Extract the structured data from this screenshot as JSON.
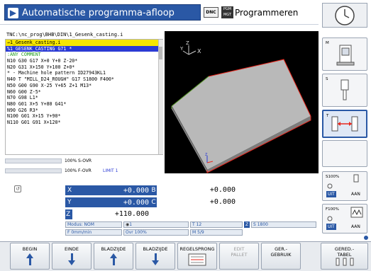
{
  "header": {
    "mode_title": "Automatische programma-afloop",
    "dnc_label": "DNC",
    "pgm_label": "PGM MGT",
    "programming_label": "Programmeren"
  },
  "program": {
    "path": "TNC:\\nc_prog\\BHB\\DIN\\1_Gesenk_casting.i",
    "lines": [
      {
        "text": "→1_Gesenk_casting.i",
        "style": "yellow"
      },
      {
        "text": "%1_GESENK_CASTING G71 *",
        "style": "blue"
      },
      {
        "text": ":ANY COMMENT",
        "style": "comment"
      },
      {
        "text": "N10 G30 G17 X+0 Y+0 Z-20*",
        "style": "normal"
      },
      {
        "text": "N20 G31 X+150 Y+100 Z+0*",
        "style": "normal"
      },
      {
        "text": "* - Machine hole pattern ID27943KL1",
        "style": "normal"
      },
      {
        "text": "N40 T \"MILL_D24_ROUGH\" G17 S1800 F400*",
        "style": "normal"
      },
      {
        "text": "N50 G00 G90 X-25 Y+65 Z+1 M13*",
        "style": "normal"
      },
      {
        "text": "N60 G00 Z-5*",
        "style": "normal"
      },
      {
        "text": "N70 G98 L1*",
        "style": "normal"
      },
      {
        "text": "N80 G01 X+5 Y+80 G41*",
        "style": "normal"
      },
      {
        "text": "N90 G26 R3*",
        "style": "normal"
      },
      {
        "text": "N100 G01 X+15 Y+90*",
        "style": "normal"
      },
      {
        "text": "N110 G01 G91 X+120*",
        "style": "normal"
      }
    ]
  },
  "overrides": {
    "s_ovr": "100% S-OVR",
    "f_ovr": "100% F-OVR",
    "limit": "LIMIT 1"
  },
  "view": {
    "axis_z": "Z",
    "axis_y": "Y",
    "axis_x": "X",
    "origin_z": "Z",
    "origin_y": "Y",
    "origin_x": "X",
    "colors": {
      "block_top": "#b9b9b9",
      "block_front": "#7d7d7d",
      "block_side": "#8a8a8a",
      "edge": "#e8281e"
    }
  },
  "positions": {
    "rows": [
      {
        "left_axis": "X",
        "left_value": "+0.000",
        "right_axis": "B",
        "right_value": "+0.000"
      },
      {
        "left_axis": "Y",
        "left_value": "+0.000",
        "right_axis": "C",
        "right_value": "+0.000"
      },
      {
        "left_axis": "Z",
        "left_value": "+110.000",
        "right_axis": "",
        "right_value": ""
      }
    ],
    "modus": "Modus: NOM",
    "tool_num": "1",
    "t_field": "T  12",
    "s_axis": "Z",
    "s_field": "S  1800",
    "f_field": "F  0mm/min",
    "ovr_field": "Ovr 100%",
    "m_field": "M  5/9"
  },
  "right_keys": {
    "m_label": "M",
    "s_label": "S",
    "t_label": "T",
    "s100": "S100%",
    "uit1": "UIT",
    "aan1": "AAN",
    "f100": "F100%",
    "uit2": "UIT",
    "aan2": "AAN"
  },
  "softkeys": [
    {
      "line1": "BEGIN",
      "line2": "",
      "arrow": "up"
    },
    {
      "line1": "EINDE",
      "line2": "",
      "arrow": "down"
    },
    {
      "line1": "BLADZIJDE",
      "line2": "",
      "arrow": "up"
    },
    {
      "line1": "BLADZIJDE",
      "line2": "",
      "arrow": "down"
    },
    {
      "line1": "REGELSPRONG",
      "line2": "",
      "arrow": "none"
    },
    {
      "line1": "EDIT",
      "line2": "PALLET",
      "arrow": "none"
    },
    {
      "line1": "GER.-",
      "line2": "GEBRUIK",
      "arrow": "none"
    },
    {
      "line1": "GERED.-",
      "line2": "TABEL",
      "arrow": "none"
    }
  ]
}
